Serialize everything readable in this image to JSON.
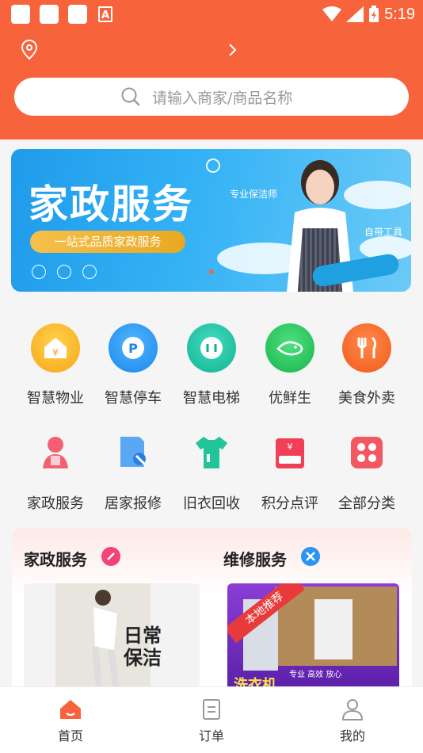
{
  "status": {
    "time": "5:19",
    "notif_a": "A"
  },
  "search": {
    "placeholder": "请输入商家/商品名称"
  },
  "banner": {
    "title": "家政服务",
    "subtitle": "一站式品质家政服务",
    "tag1": "专业保洁师",
    "tag2": "自带工具"
  },
  "grid": {
    "row1": [
      {
        "label": "智慧物业",
        "icon": "property-icon",
        "color": "#f9b81b"
      },
      {
        "label": "智慧停车",
        "icon": "parking-icon",
        "color": "#2b9cf2"
      },
      {
        "label": "智慧电梯",
        "icon": "elevator-icon",
        "color": "#1fc4a3"
      },
      {
        "label": "优鲜生",
        "icon": "fresh-fish-icon",
        "color": "#27c45d"
      },
      {
        "label": "美食外卖",
        "icon": "food-delivery-icon",
        "color": "#f7622a"
      }
    ],
    "row2": [
      {
        "label": "家政服务",
        "icon": "housekeeping-icon",
        "color": "#f26072"
      },
      {
        "label": "居家报修",
        "icon": "repair-icon",
        "color": "#3a8ff0"
      },
      {
        "label": "旧衣回收",
        "icon": "clothes-recycle-icon",
        "color": "#21c597"
      },
      {
        "label": "积分点评",
        "icon": "points-review-icon",
        "color": "#f04058"
      },
      {
        "label": "全部分类",
        "icon": "all-categories-icon",
        "color": "#f3575f"
      }
    ]
  },
  "services": {
    "left_title": "家政服务",
    "right_title": "维修服务",
    "left_img_text1": "日常",
    "left_img_text2": "保洁",
    "right_img_ribbon": "本地推荐",
    "right_img_tag": "专业 高效 放心",
    "right_img_text": "洗衣机"
  },
  "nav": {
    "home": "首页",
    "orders": "订单",
    "mine": "我的"
  },
  "colors": {
    "brand": "#f7643c"
  }
}
